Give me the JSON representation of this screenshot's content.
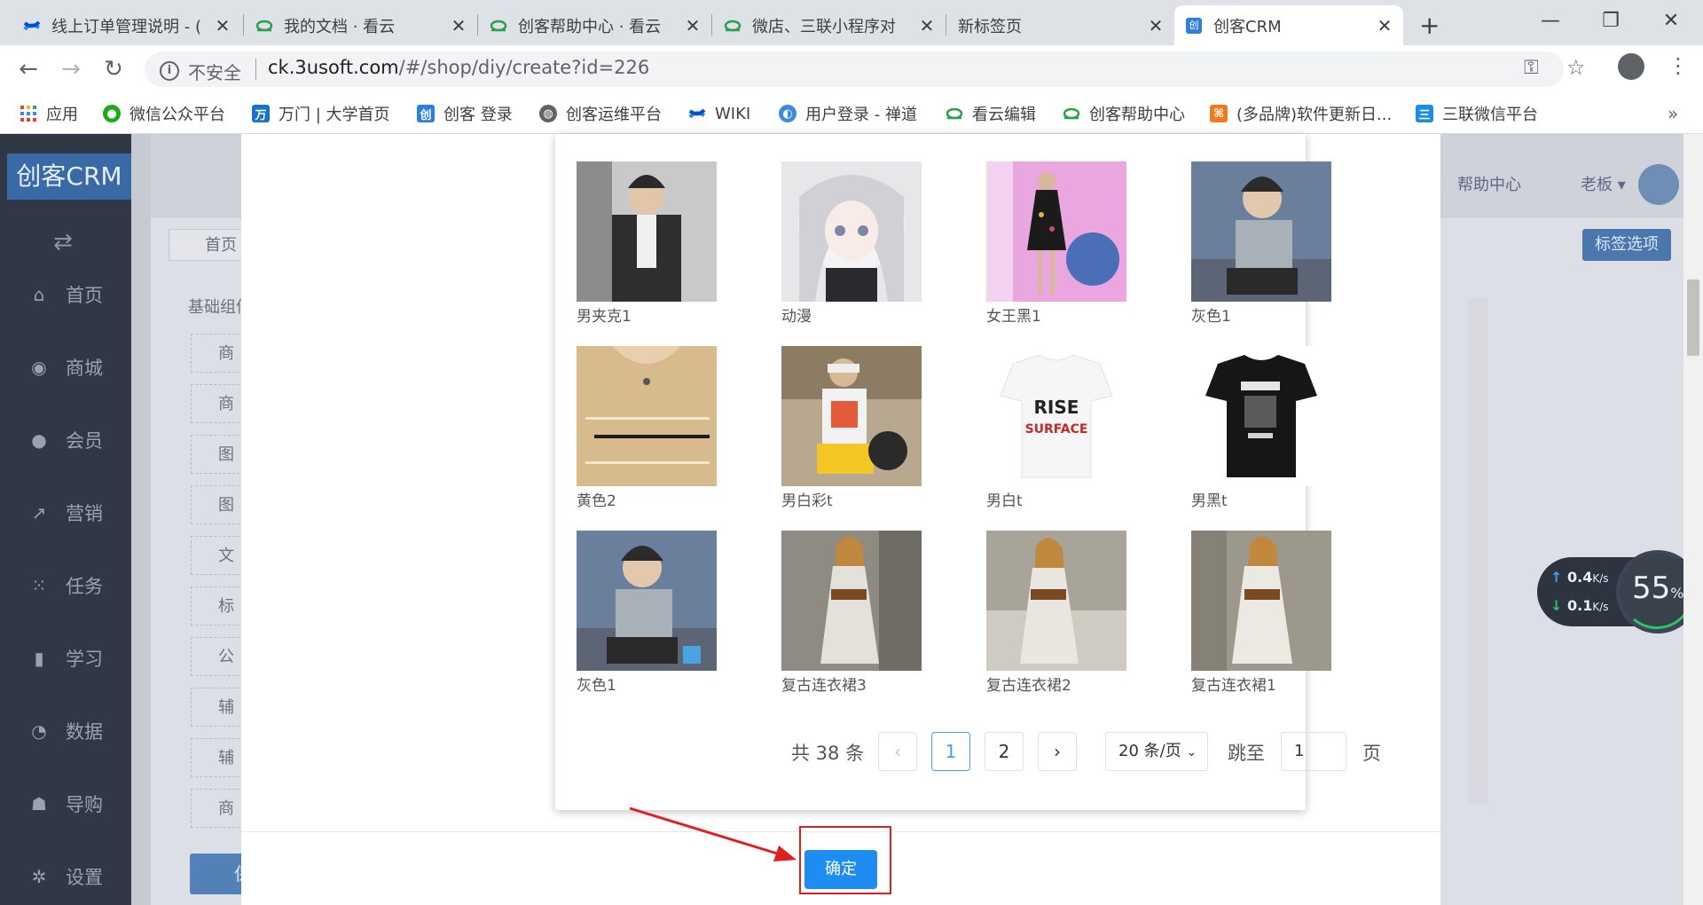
{
  "browser": {
    "tabs": [
      {
        "label": "线上订单管理说明 - (",
        "icon": "confluence-icon"
      },
      {
        "label": "我的文档 · 看云",
        "icon": "kancloud-icon"
      },
      {
        "label": "创客帮助中心 · 看云",
        "icon": "kancloud-icon"
      },
      {
        "label": "微店、三联小程序对",
        "icon": "kancloud-icon"
      },
      {
        "label": "新标签页",
        "icon": ""
      },
      {
        "label": "创客CRM",
        "icon": "chuangke-icon"
      }
    ],
    "address": {
      "security": "不安全",
      "host": "ck.3usoft.com",
      "path": "/#/shop/diy/create?id=226"
    },
    "bookmarks": [
      {
        "label": "应用",
        "icon": "apps-grid-icon"
      },
      {
        "label": "微信公众平台",
        "icon": "wechat-icon"
      },
      {
        "label": "万门 | 大学首页",
        "icon": "wanmen-icon"
      },
      {
        "label": "创客 登录",
        "icon": "chuangke-icon"
      },
      {
        "label": "创客运维平台",
        "icon": "globe-icon"
      },
      {
        "label": "WIKI",
        "icon": "confluence-icon"
      },
      {
        "label": "用户登录 - 禅道",
        "icon": "chandao-icon"
      },
      {
        "label": "看云编辑",
        "icon": "kancloud-icon"
      },
      {
        "label": "创客帮助中心",
        "icon": "kancloud-icon"
      },
      {
        "label": "(多品牌)软件更新日...",
        "icon": "multibrand-icon"
      },
      {
        "label": "三联微信平台",
        "icon": "sanlian-icon"
      }
    ]
  },
  "app": {
    "logo": "创客CRM",
    "nav": [
      {
        "label": "首页",
        "icon": "home-icon"
      },
      {
        "label": "商城",
        "icon": "shop-icon"
      },
      {
        "label": "会员",
        "icon": "member-icon"
      },
      {
        "label": "营销",
        "icon": "trend-icon"
      },
      {
        "label": "任务",
        "icon": "grid-icon"
      },
      {
        "label": "学习",
        "icon": "book-icon"
      },
      {
        "label": "数据",
        "icon": "pie-icon"
      },
      {
        "label": "导购",
        "icon": "group-icon"
      },
      {
        "label": "设置",
        "icon": "gear-icon"
      }
    ],
    "header": {
      "help": "帮助中心",
      "user": "老板",
      "tag_button": "标签选项"
    },
    "home_tab": "首页",
    "base_components": "基础组件",
    "left_boxes": [
      "商",
      "商品",
      "图片",
      "图文",
      "文",
      "标",
      "公",
      "辅助",
      "辅",
      "商品"
    ],
    "save_button": "保"
  },
  "modal": {
    "images": [
      {
        "name": "男夹克1",
        "swatch": "#3a3a3a"
      },
      {
        "name": "动漫",
        "swatch": "#d9d9de"
      },
      {
        "name": "女王黑1",
        "swatch": "#e39ad8"
      },
      {
        "name": "灰色1",
        "swatch": "#8e949a"
      },
      {
        "name": "黄色2",
        "swatch": "#d7b98a"
      },
      {
        "name": "男白彩t",
        "swatch": "#b8a88f"
      },
      {
        "name": "男白t",
        "swatch": "#f5f5f5"
      },
      {
        "name": "男黑t",
        "swatch": "#1e1e1e"
      },
      {
        "name": "灰色1",
        "swatch": "#8e949a"
      },
      {
        "name": "复古连衣裙3",
        "swatch": "#9a9688"
      },
      {
        "name": "复古连衣裙2",
        "swatch": "#a8a49a"
      },
      {
        "name": "复古连衣裙1",
        "swatch": "#9c988c"
      }
    ],
    "pagination": {
      "total": "共 38 条",
      "pages": [
        "1",
        "2"
      ],
      "prev": "‹",
      "next": "›",
      "page_size": "20 条/页",
      "jump_label": "跳至",
      "jump_value": "1",
      "suffix": "页"
    },
    "confirm": "确定"
  },
  "widget": {
    "up": "0.4",
    "down": "0.1",
    "unit": "K/s",
    "cpu": "55",
    "cpu_unit": "%"
  }
}
